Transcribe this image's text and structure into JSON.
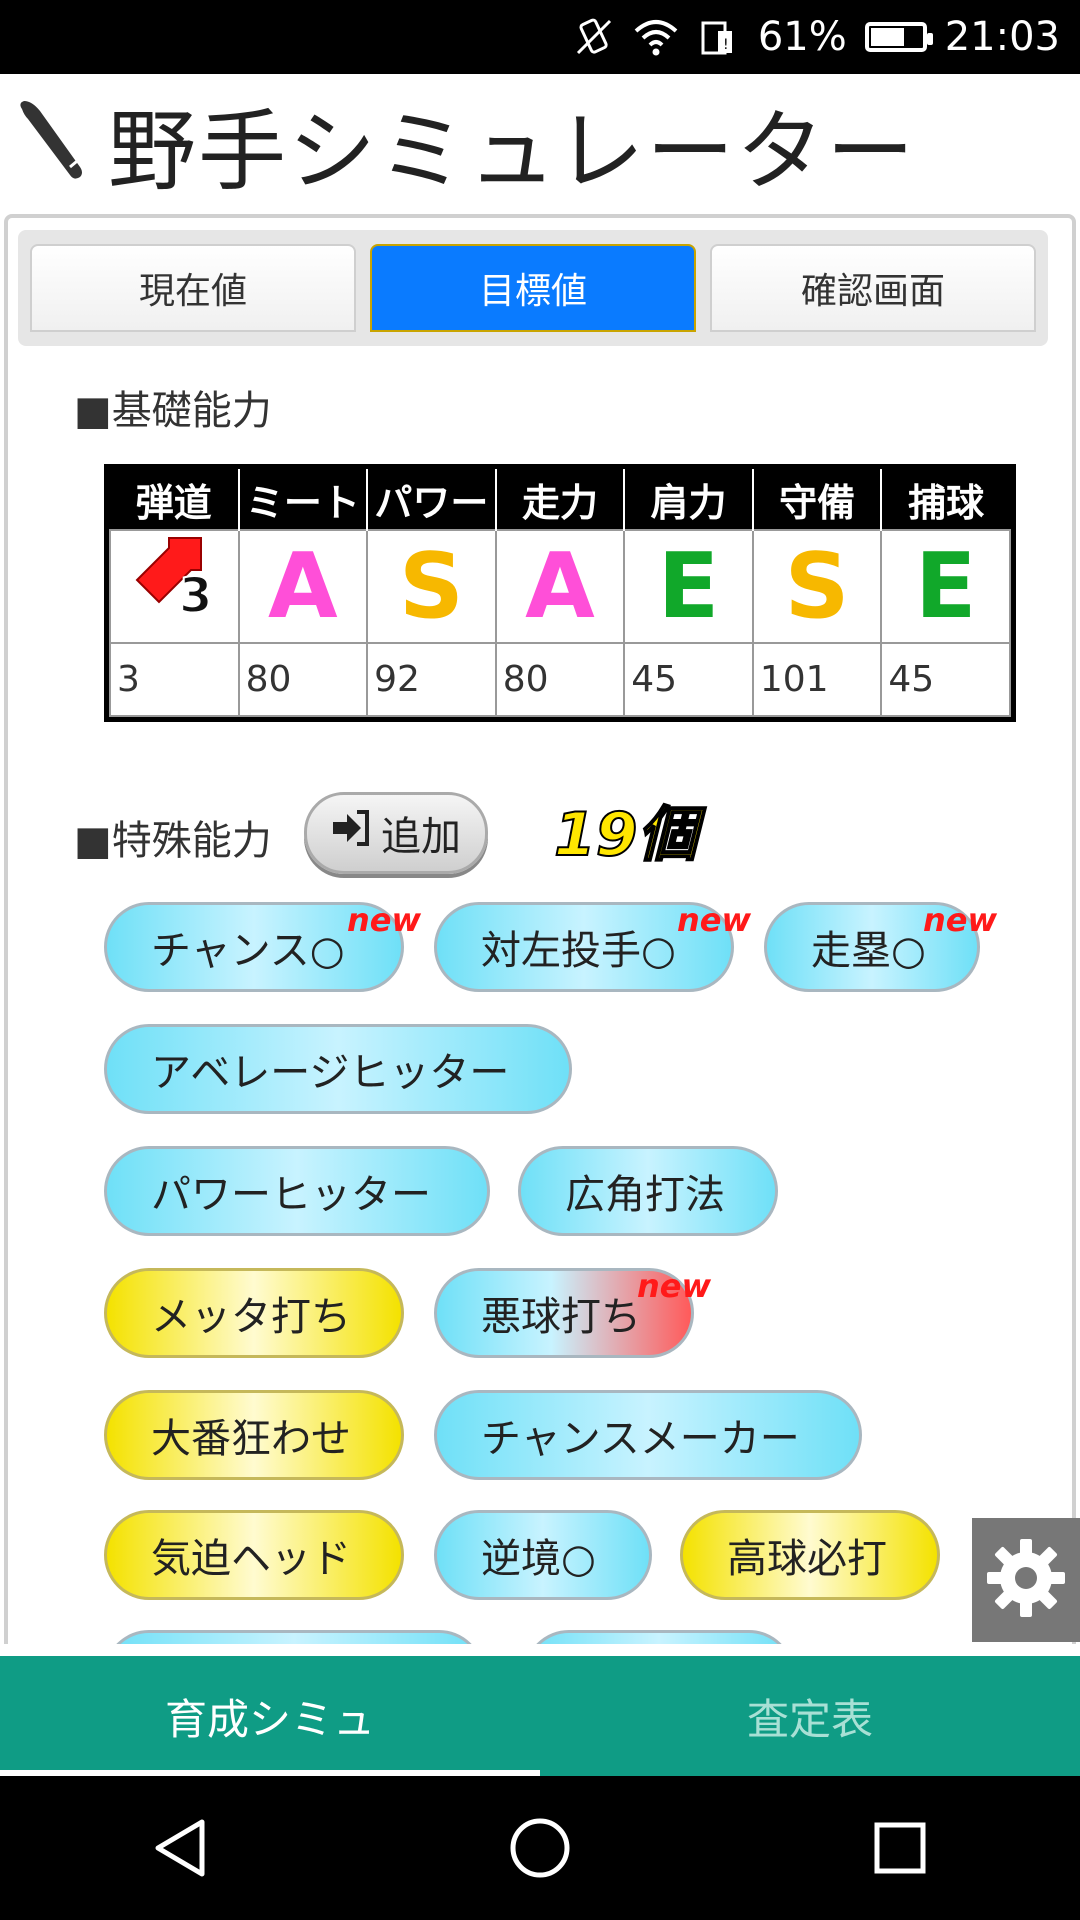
{
  "status_bar": {
    "battery": "61%",
    "time": "21:03",
    "battery_level": 0.61
  },
  "header": {
    "title": "野手シミュレーター",
    "icon": "baseball-bat-icon"
  },
  "tabs": [
    {
      "label": "現在値",
      "active": false
    },
    {
      "label": "目標値",
      "active": true
    },
    {
      "label": "確認画面",
      "active": false
    }
  ],
  "basic": {
    "title": "■基礎能力",
    "headers": [
      "弾道",
      "ミート",
      "パワー",
      "走力",
      "肩力",
      "守備",
      "捕球"
    ],
    "trajectory_grade": "3",
    "grades": [
      "A",
      "S",
      "A",
      "E",
      "S",
      "E"
    ],
    "values": [
      "3",
      "80",
      "92",
      "80",
      "45",
      "101",
      "45"
    ]
  },
  "special": {
    "title": "■特殊能力",
    "add_label": "追加",
    "count": "19個",
    "new_tag": "new",
    "skills": [
      {
        "label": "チャンス○",
        "color": "blue",
        "new": true
      },
      {
        "label": "対左投手○",
        "color": "blue",
        "new": true
      },
      {
        "label": "走塁○",
        "color": "blue",
        "new": true
      },
      {
        "label": "アベレージヒッター",
        "color": "blue",
        "new": false
      },
      {
        "label": "パワーヒッター",
        "color": "blue",
        "new": false
      },
      {
        "label": "広角打法",
        "color": "blue",
        "new": false
      },
      {
        "label": "メッタ打ち",
        "color": "yellow",
        "new": false
      },
      {
        "label": "悪球打ち",
        "color": "red",
        "new": true
      },
      {
        "label": "大番狂わせ",
        "color": "yellow",
        "new": false
      },
      {
        "label": "チャンスメーカー",
        "color": "blue",
        "new": false
      },
      {
        "label": "気迫ヘッド",
        "color": "yellow",
        "new": false
      },
      {
        "label": "逆境○",
        "color": "blue",
        "new": false
      },
      {
        "label": "高球必打",
        "color": "yellow",
        "new": false
      }
    ]
  },
  "bottom_tabs": [
    {
      "label": "育成シミュ",
      "active": true
    },
    {
      "label": "査定表",
      "active": false
    }
  ],
  "colors": {
    "accent_tab": "#0a7bff",
    "bottom_bar": "#0f9c85",
    "grade_A": "#ff4fd8",
    "grade_S": "#f7b800",
    "grade_E": "#11a82a"
  }
}
